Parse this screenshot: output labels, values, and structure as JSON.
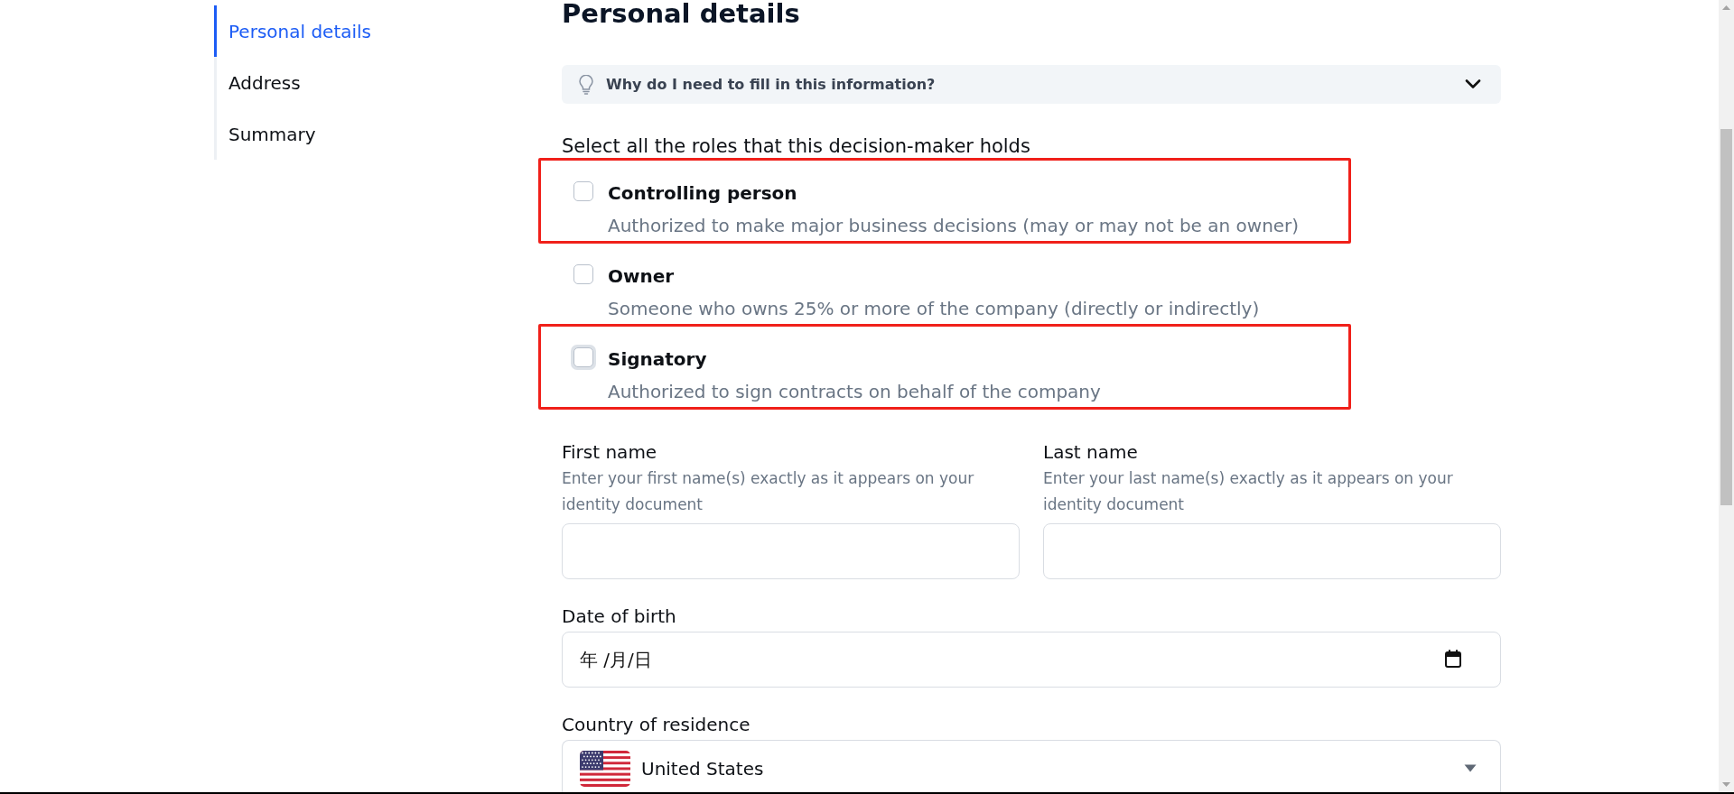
{
  "sidebar": {
    "items": [
      {
        "label": "Personal details",
        "selected": true
      },
      {
        "label": "Address",
        "selected": false
      },
      {
        "label": "Summary",
        "selected": false
      }
    ]
  },
  "heading": "Personal details",
  "info_panel": {
    "question": "Why do I need to fill in this information?",
    "expanded": false
  },
  "roles": {
    "prompt": "Select all the roles that this decision-maker holds",
    "options": [
      {
        "title": "Controlling person",
        "description": "Authorized to make major business decisions (may or may not be an owner)",
        "checked": false,
        "focused": false,
        "highlighted": true
      },
      {
        "title": "Owner",
        "description": "Someone who owns 25% or more of the company (directly or indirectly)",
        "checked": false,
        "focused": false,
        "highlighted": false
      },
      {
        "title": "Signatory",
        "description": "Authorized to sign contracts on behalf of the company",
        "checked": false,
        "focused": true,
        "highlighted": true
      }
    ]
  },
  "field_rows": [
    [
      {
        "kind": "text",
        "label": "First name",
        "help": "Enter your first name(s) exactly as it appears on your identity document"
      },
      {
        "kind": "text",
        "label": "Last name",
        "help": "Enter your last name(s) exactly as it appears on your identity document"
      }
    ],
    [
      {
        "kind": "date",
        "label": "Date of birth",
        "placeholder": "年 /月/日"
      }
    ],
    [
      {
        "kind": "select",
        "label": "Country of residence",
        "value": "United States"
      }
    ]
  ]
}
